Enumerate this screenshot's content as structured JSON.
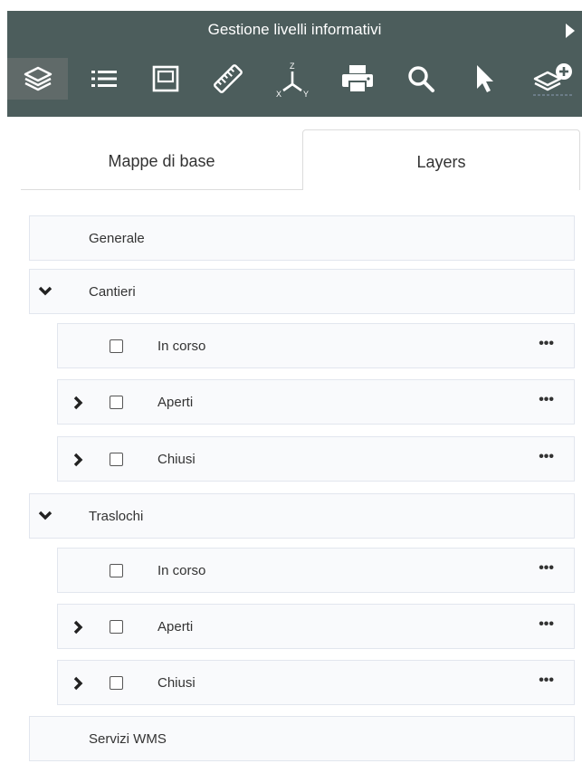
{
  "header": {
    "title": "Gestione livelli informativi",
    "tools": [
      {
        "icon": "layers-icon",
        "active": true
      },
      {
        "icon": "list-icon"
      },
      {
        "icon": "frame-icon"
      },
      {
        "icon": "ruler-icon"
      },
      {
        "icon": "xyz-axes-icon",
        "axis_labels": [
          "Z",
          "X",
          "Y"
        ]
      },
      {
        "icon": "printer-icon"
      },
      {
        "icon": "search-icon"
      },
      {
        "icon": "pointer-icon"
      },
      {
        "icon": "add-layer-icon"
      }
    ]
  },
  "tabs": {
    "base_maps": "Mappe di base",
    "layers": "Layers"
  },
  "tree": {
    "generale": "Generale",
    "cantieri": {
      "label": "Cantieri",
      "items": [
        {
          "label": "In corso",
          "more": "•••"
        },
        {
          "label": "Aperti",
          "more": "•••"
        },
        {
          "label": "Chiusi",
          "more": "•••"
        }
      ]
    },
    "traslochi": {
      "label": "Traslochi",
      "items": [
        {
          "label": "In corso",
          "more": "•••"
        },
        {
          "label": "Aperti",
          "more": "•••"
        },
        {
          "label": "Chiusi",
          "more": "•••"
        }
      ]
    },
    "wms": "Servizi WMS"
  },
  "colors": {
    "header_bg": "#4c5d5c",
    "active_tool_bg": "#606a69",
    "row_bg": "#f9fafc",
    "row_border": "#e2e6ee"
  }
}
